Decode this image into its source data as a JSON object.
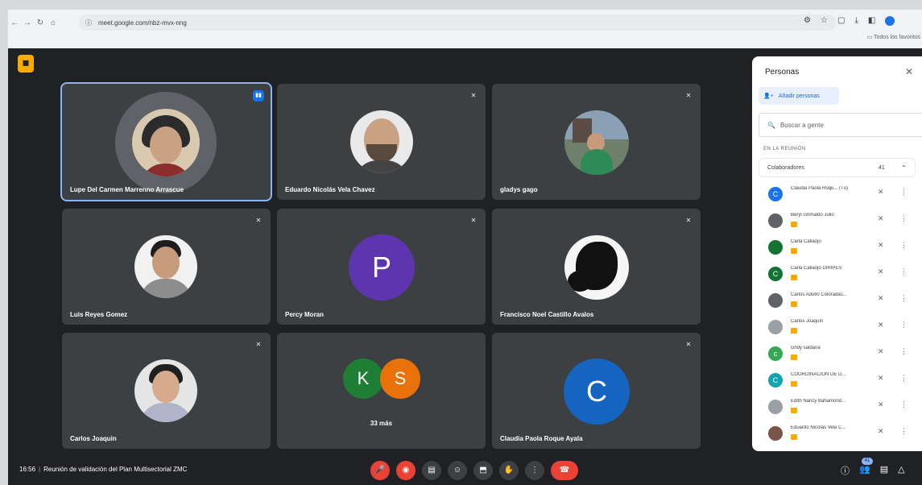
{
  "browser": {
    "url": "meet.google.com/nbz-mvx-nng",
    "bookmarks_label": "Todos los favoritos",
    "nav_icons": [
      "back-icon",
      "forward-icon",
      "reload-icon",
      "home-icon"
    ]
  },
  "tiles": [
    {
      "name": "Lupe Del Carmen Marrenno Arrascue",
      "speaking": true
    },
    {
      "name": "Eduardo Nicolás Vela Chavez"
    },
    {
      "name": "gladys gago"
    },
    {
      "name": "Luis Reyes Gomez"
    },
    {
      "name": "Percy Moran",
      "letter": "P"
    },
    {
      "name": "Francisco Noel Castillo Avalos"
    },
    {
      "name": "Carlos Joaquin"
    },
    {
      "name": "",
      "letters": [
        "K",
        "S"
      ],
      "more": "33 más"
    },
    {
      "name": "Claudia Paola Roque Ayala",
      "letter": "C"
    }
  ],
  "panel": {
    "title": "Personas",
    "add_label": "Añadir personas",
    "search_placeholder": "Buscar a gente",
    "section": "EN LA REUNIÓN",
    "group_label": "Colaboradores",
    "group_count": "41",
    "people": [
      {
        "name": "Claudia Paola Roqu... (Tú)",
        "initial": "C",
        "color": "#1a73e8"
      },
      {
        "name": "Beryl Grimaldo Julio",
        "initial": "",
        "color": "#5f6368"
      },
      {
        "name": "Carla Callaojo",
        "initial": "",
        "color": "#137333"
      },
      {
        "name": "Carla Callaojo DIRIPES",
        "initial": "C",
        "color": "#137333"
      },
      {
        "name": "Carlos Adolfo Coloradas...",
        "initial": "",
        "color": "#5f6368"
      },
      {
        "name": "Carlos Joaquín",
        "initial": "",
        "color": "#9aa0a6"
      },
      {
        "name": "cindy saldaña",
        "initial": "c",
        "color": "#34a853"
      },
      {
        "name": "COORDINACION DE G...",
        "initial": "C",
        "color": "#12a4af"
      },
      {
        "name": "Edith Nancy Bahamond...",
        "initial": "",
        "color": "#9aa0a6"
      },
      {
        "name": "Eduardo Nicolás Vela C...",
        "initial": "",
        "color": "#795548"
      }
    ]
  },
  "bottom": {
    "time": "16:56",
    "meeting_title": "Reunión de validación del Plan Multisectorial ZMC",
    "participant_count": "41"
  },
  "colors": {
    "background": "#202124",
    "tile": "#3c4043",
    "accent": "#1a73e8",
    "danger": "#ea4335"
  }
}
